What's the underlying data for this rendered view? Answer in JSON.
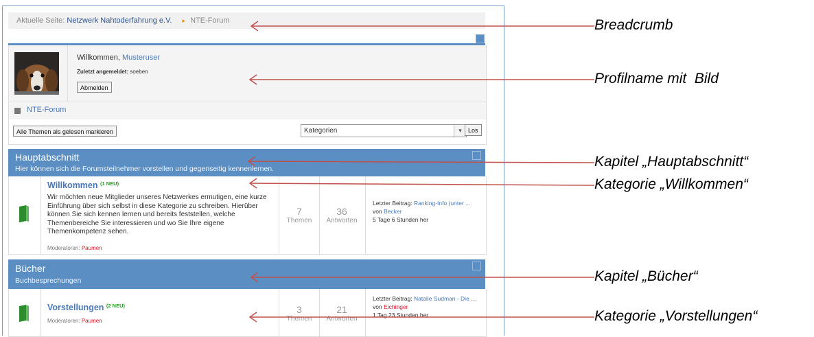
{
  "breadcrumb": {
    "prefix": "Aktuelle Seite:",
    "home": "Netzwerk Nahtoderfahrung e.V.",
    "separator": "▸",
    "current": "NTE-Forum"
  },
  "profile": {
    "welcome_text": "Willkommen,",
    "username": "Musteruser",
    "last_login_label": "Zuletzt angemeldet:",
    "last_login_value": "soeben",
    "logout_label": "Abmelden"
  },
  "forum_nav": {
    "label": "NTE-Forum"
  },
  "toolbar": {
    "mark_read_label": "Alle Themen als gelesen markieren",
    "category_select_value": "Kategorien",
    "go_label": "Los"
  },
  "sections": [
    {
      "title": "Hauptabschnitt",
      "subtitle": "Hier können sich die Forumsteilnehmer vorstellen und gegenseitig kennenlernen.",
      "category": {
        "title": "Willkommen",
        "new_badge": "(1 NEU)",
        "description": "Wir möchten neue Mitglieder unseres Netzwerkes ermutigen, eine kurze Einführung über sich selbst in diese Kategorie zu schreiben. Hierüber können Sie sich kennen lernen und bereits feststellen, welche Themenbereiche Sie interessieren und wo Sie Ihre eigene Themenkompetenz sehen.",
        "moderators_label": "Moderatoren:",
        "moderator": "Paumen",
        "topics_count": "7",
        "topics_label": "Themen",
        "replies_count": "36",
        "replies_label": "Antworten",
        "last_post_label": "Letzter Beitrag:",
        "last_post_title": "Ranking-Info (unter ...",
        "by_label": "von",
        "last_post_author": "Becker",
        "last_post_time": "5 Tage 6 Stunden her"
      }
    },
    {
      "title": "Bücher",
      "subtitle": "Buchbesprechungen",
      "category": {
        "title": "Vorstellungen",
        "new_badge": "(2 NEU)",
        "moderators_label": "Moderatoren:",
        "moderator": "Paumen",
        "topics_count": "3",
        "topics_label": "Themen",
        "replies_count": "21",
        "replies_label": "Antworten",
        "last_post_label": "Letzter Beitrag:",
        "last_post_title": "Natalie Sudman - Die ...",
        "by_label": "von",
        "last_post_author": "Eichinger",
        "last_post_time": "1 Tag 23 Stunden her"
      }
    }
  ],
  "annotations": {
    "breadcrumb": "Breadcrumb",
    "profile": "Profilname mit  Bild",
    "chapter_main": "Kapitel „Hauptabschnitt“",
    "category_welcome": "Kategorie „Willkommen“",
    "chapter_books": "Kapitel „Bücher“",
    "category_intro": "Kategorie „Vorstellungen“"
  },
  "colors": {
    "section_header": "#5b8ec2",
    "annotation_arrow": "#c0504d",
    "link": "#4a78b8",
    "new_badge": "#2a9d2a",
    "moderator": "#dd1122"
  }
}
